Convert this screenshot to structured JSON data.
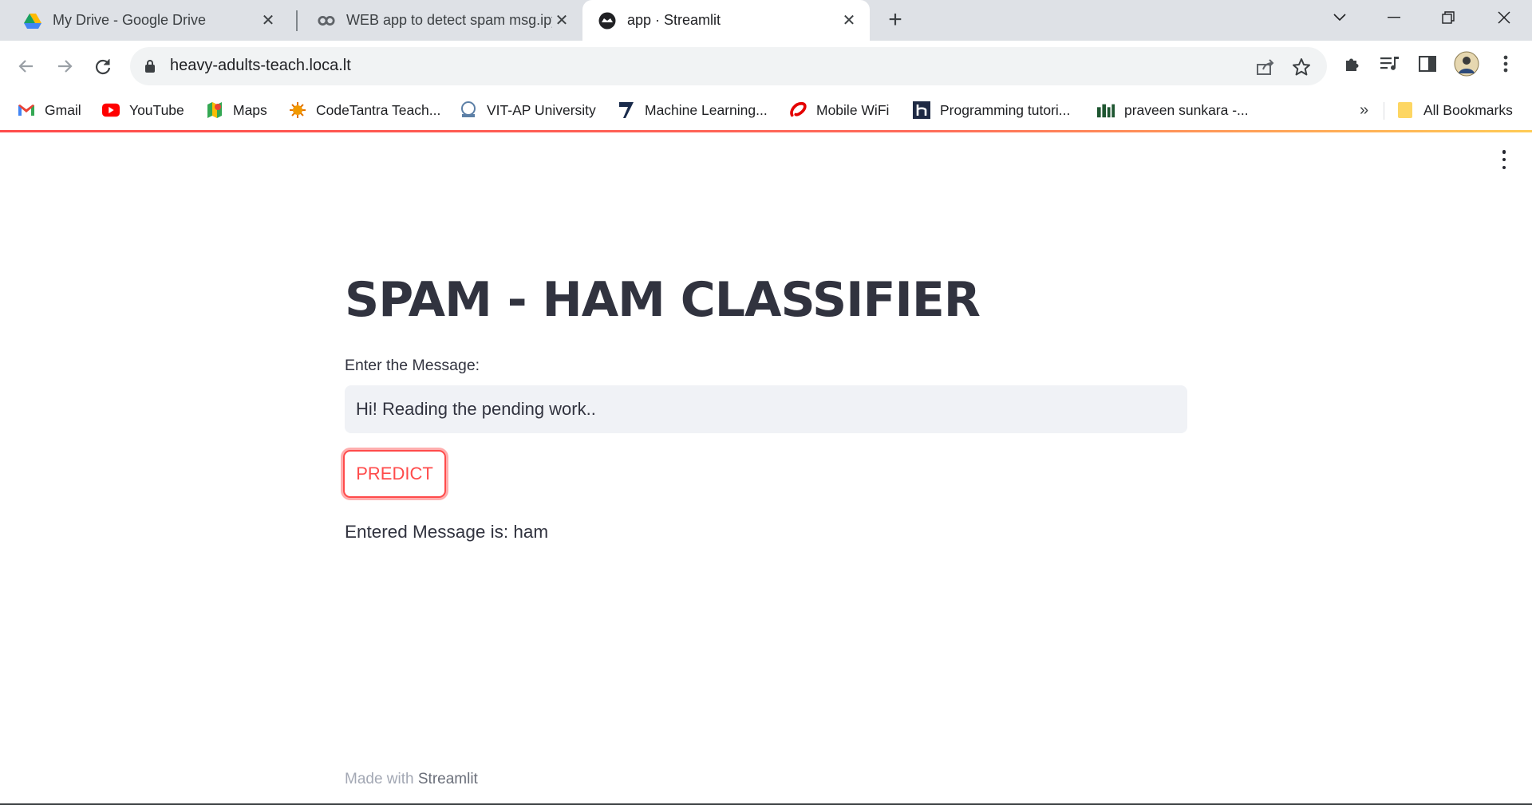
{
  "browser": {
    "tabs": [
      {
        "title": "My Drive - Google Drive",
        "icon": "google-drive-icon"
      },
      {
        "title": "WEB app to detect spam msg.ipynb",
        "icon": "colab-icon"
      },
      {
        "title": "app · Streamlit",
        "icon": "streamlit-icon",
        "active": true
      }
    ],
    "url": "heavy-adults-teach.loca.lt",
    "bookmarks": [
      {
        "label": "Gmail",
        "icon": "gmail-icon"
      },
      {
        "label": "YouTube",
        "icon": "youtube-icon"
      },
      {
        "label": "Maps",
        "icon": "maps-icon"
      },
      {
        "label": "CodeTantra Teach...",
        "icon": "codetantra-icon"
      },
      {
        "label": "VIT-AP University",
        "icon": "vitap-icon"
      },
      {
        "label": "Machine Learning...",
        "icon": "ml-icon"
      },
      {
        "label": "Mobile WiFi",
        "icon": "airtel-icon"
      },
      {
        "label": "Programming tutori...",
        "icon": "hackr-icon"
      },
      {
        "label": "praveen sunkara -...",
        "icon": "site-icon"
      }
    ],
    "more_label": "»",
    "all_bookmarks": "All Bookmarks"
  },
  "app": {
    "title": "SPAM - HAM CLASSIFIER",
    "input_label": "Enter the Message:",
    "input_value": "Hi! Reading the pending work..",
    "button_label": "PREDICT",
    "result": "Entered Message is: ham",
    "footer_prefix": "Made with ",
    "footer_brand": "Streamlit"
  },
  "colors": {
    "accent": "#ff4b4b",
    "text": "#31333f",
    "input_bg": "#f0f2f6",
    "tabstrip_bg": "#dee1e6"
  }
}
